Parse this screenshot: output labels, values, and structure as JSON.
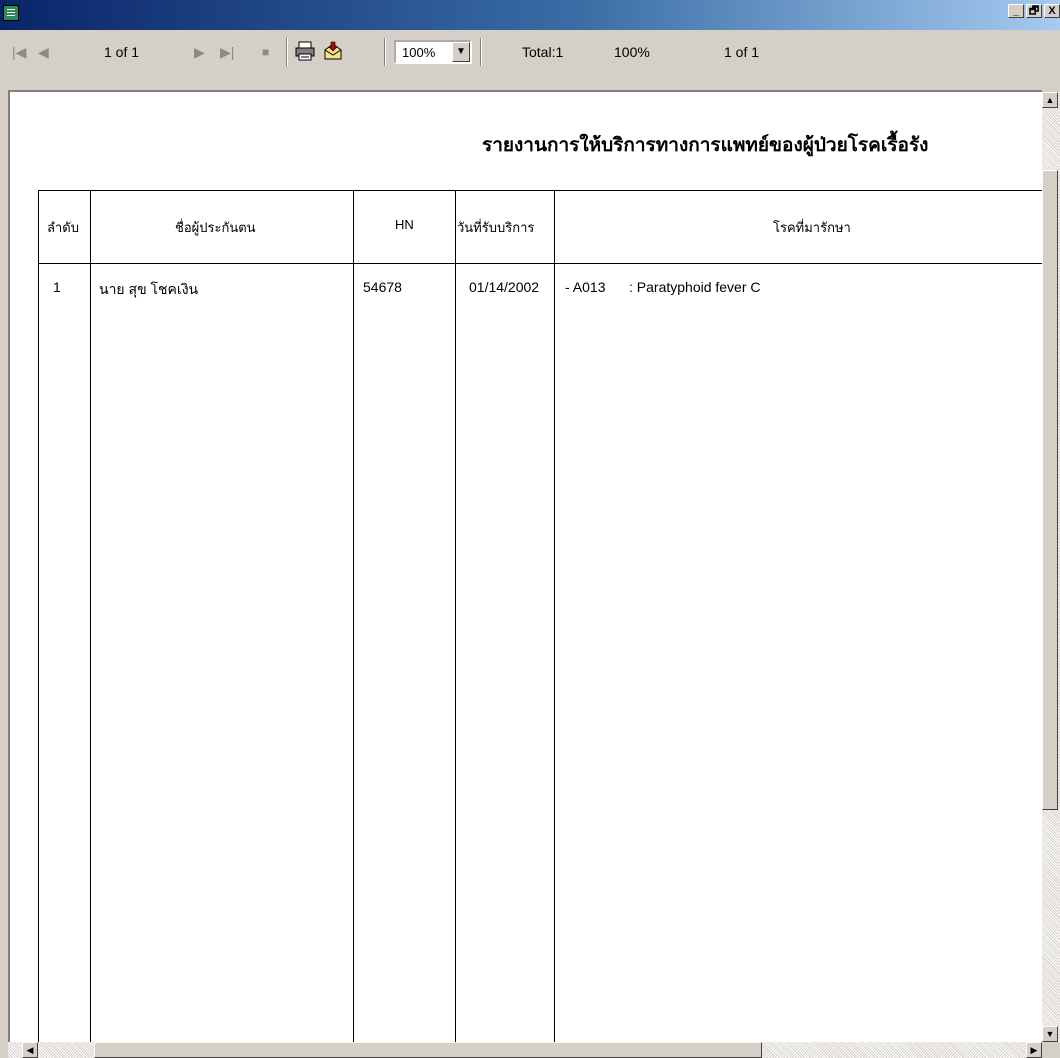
{
  "window": {
    "app_icon": "report-icon",
    "minimize": "_",
    "maximize": "□",
    "close": "X"
  },
  "toolbar": {
    "page_indicator": "1 of 1",
    "zoom": "100%",
    "total": "Total:1",
    "status_zoom": "100%",
    "status_page": "1 of 1"
  },
  "report": {
    "title": "รายงานการให้บริการทางการแพทย์ของผู้ป่วยโรคเรื้อรัง",
    "columns": [
      "ลำดับ",
      "ชื่อผู้ประกันตน",
      "HN",
      "วันที่รับบริการ",
      "โรคที่มารักษา"
    ],
    "rows": [
      {
        "no": "1",
        "name": "นาย สุข โชคเงิน",
        "hn": "54678",
        "date": "01/14/2002",
        "code": "- A013",
        "disease": ": Paratyphoid fever C"
      }
    ]
  }
}
